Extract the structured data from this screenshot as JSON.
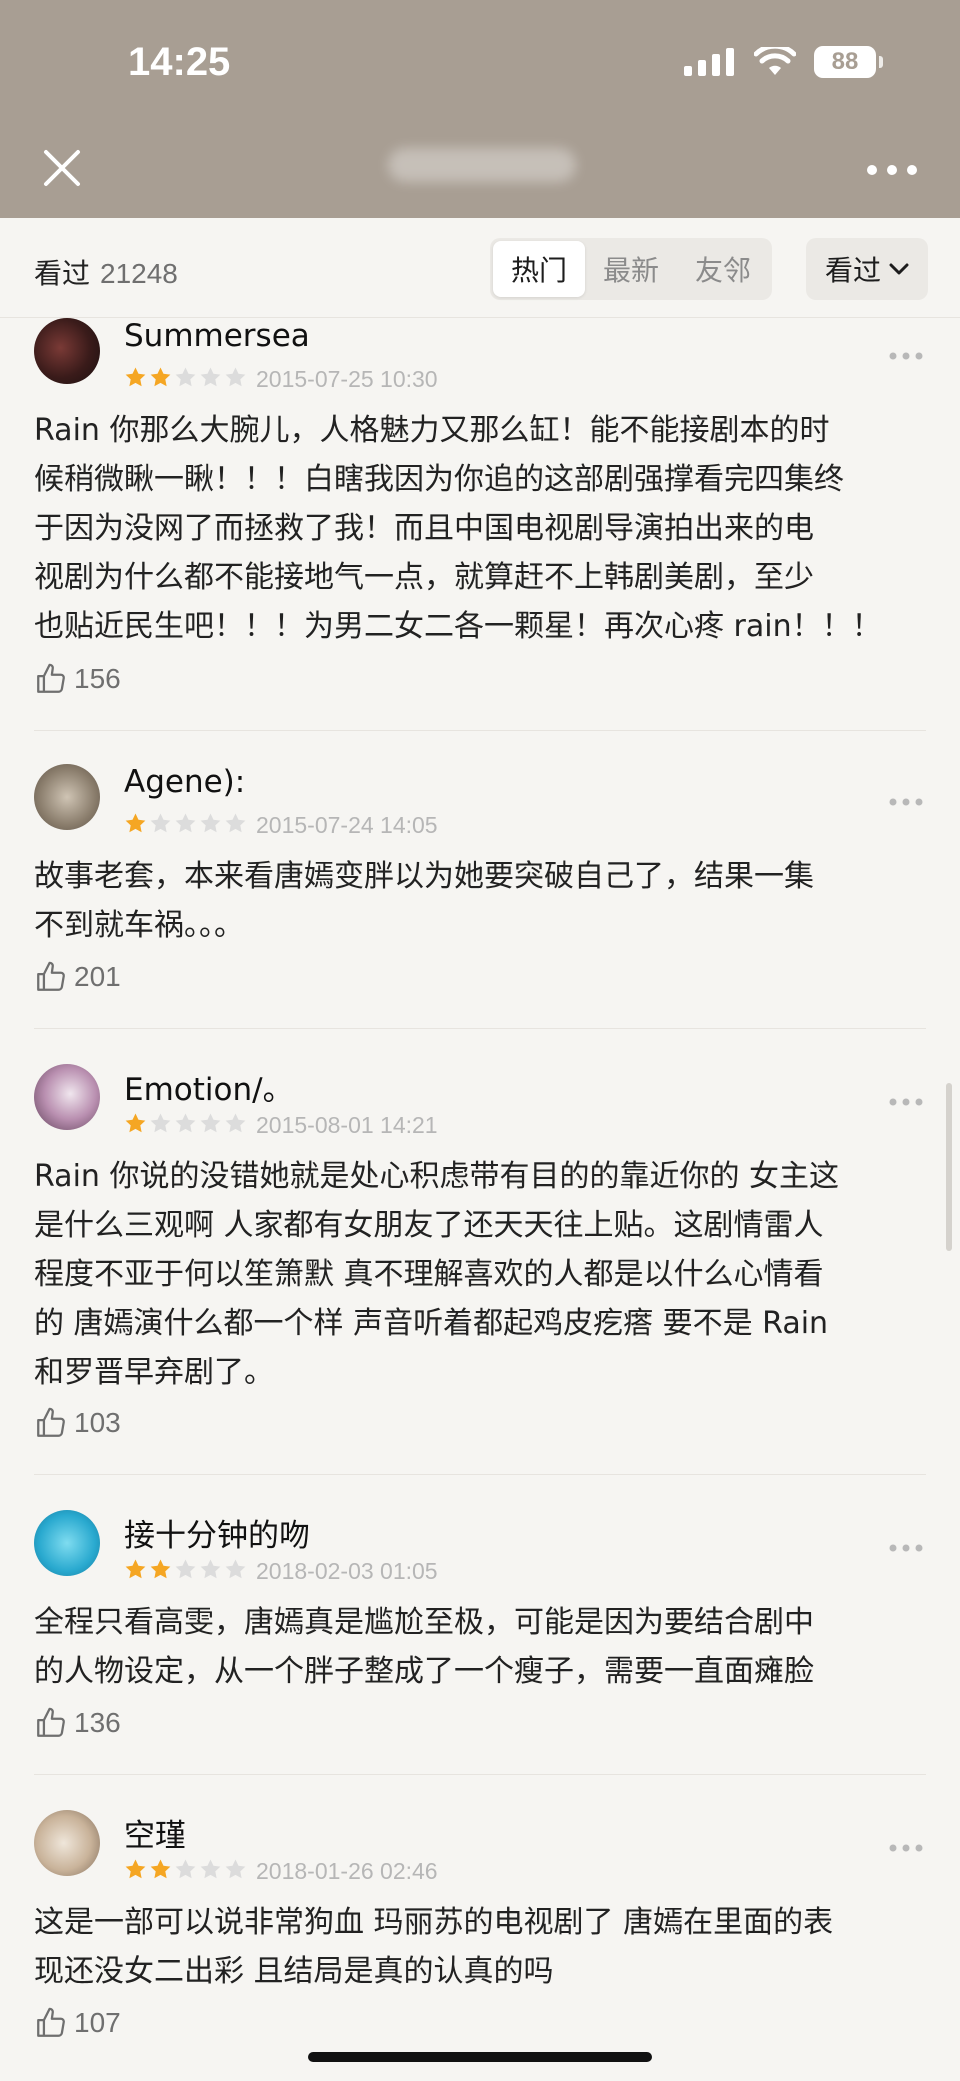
{
  "status_bar": {
    "time": "14:25",
    "battery": "88"
  },
  "filter": {
    "seen_label": "看过",
    "seen_count": "21248",
    "tabs": [
      "热门",
      "最新",
      "友邻"
    ],
    "dropdown_label": "看过"
  },
  "reviews": [
    {
      "user": "Summersea",
      "rating": 2,
      "date": "2015-07-25 10:30",
      "lines": [
        "Rain 你那么大腕儿，人格魅力又那么缸！能不能接剧本的时",
        "候稍微瞅一瞅！！！白瞎我因为你追的这部剧强撑看完四集终",
        "于因为没网了而拯救了我！而且中国电视剧导演拍出来的电",
        "视剧为什么都不能接地气一点，就算赶不上韩剧美剧，至少",
        "也贴近民生吧！！！为男二女二各一颗星！再次心疼 rain！！！"
      ],
      "likes": "156"
    },
    {
      "user": "Agene):",
      "rating": 1,
      "date": "2015-07-24 14:05",
      "lines": [
        "故事老套，本来看唐嫣变胖以为她要突破自己了，结果一集",
        "不到就车祸。。。"
      ],
      "likes": "201"
    },
    {
      "user": "Emotion/。",
      "rating": 1,
      "date": "2015-08-01 14:21",
      "lines": [
        "Rain 你说的没错她就是处心积虑带有目的的靠近你的  女主这",
        "是什么三观啊 人家都有女朋友了还天天往上贴。这剧情雷人",
        "程度不亚于何以笙箫默 真不理解喜欢的人都是以什么心情看",
        "的 唐嫣演什么都一个样 声音听着都起鸡皮疙瘩 要不是 Rain",
        "和罗晋早弃剧了。"
      ],
      "likes": "103"
    },
    {
      "user": "接十分钟的吻",
      "rating": 2,
      "date": "2018-02-03 01:05",
      "lines": [
        "全程只看高雯，唐嫣真是尴尬至极，可能是因为要结合剧中",
        "的人物设定，从一个胖子整成了一个瘦子，需要一直面瘫脸"
      ],
      "likes": "136"
    },
    {
      "user": "空瑾",
      "rating": 2,
      "date": "2018-01-26 02:46",
      "lines": [
        "这是一部可以说非常狗血 玛丽苏的电视剧了 唐嫣在里面的表",
        "现还没女二出彩  且结局是真的认真的吗"
      ],
      "likes": "107"
    }
  ],
  "colors": {
    "star_filled": "#f5a623",
    "star_empty": "#dcdcdc",
    "header_bg": "#a89e93"
  }
}
